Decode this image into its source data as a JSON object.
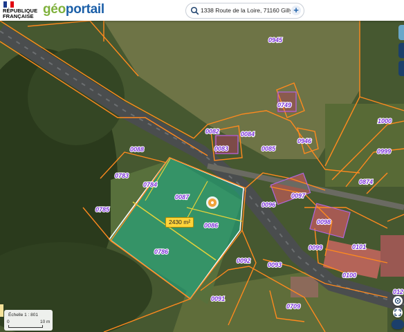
{
  "header": {
    "rf_line1": "RÉPUBLIQUE",
    "rf_line2": "FRANÇAISE",
    "logo_geo": "géo",
    "logo_portail": "portail",
    "search_value": "1338 Route de la Loire, 71160 Gilly-sur-L",
    "add_symbol": "+"
  },
  "map": {
    "selected_area": "2430 m²",
    "parcels": [
      "0945",
      "0749",
      "1000",
      "0082",
      "0084",
      "0083",
      "0085",
      "0946",
      "0999",
      "0088",
      "0874",
      "0783",
      "0784",
      "0087",
      "0097",
      "0096",
      "0785",
      "0086",
      "0098",
      "0099",
      "0101",
      "0786",
      "0092",
      "0093",
      "0100",
      "0091",
      "0709",
      "012"
    ]
  },
  "scale": {
    "label": "Échelle 1 : 801",
    "min": "0",
    "max": "10 m"
  },
  "colors": {
    "parcel_line": "#ff8a1e",
    "parcel_label": "#7a2fd8",
    "selection_fill": "#19b08a",
    "selection_line": "#e6d23a",
    "brand_blue": "#1b5fa8",
    "brand_green": "#7fb13c"
  },
  "icons": [
    "search-icon",
    "plus-icon",
    "location-marker-icon",
    "locate-icon",
    "fullscreen-icon",
    "zoom-icon",
    "tools-icon"
  ]
}
